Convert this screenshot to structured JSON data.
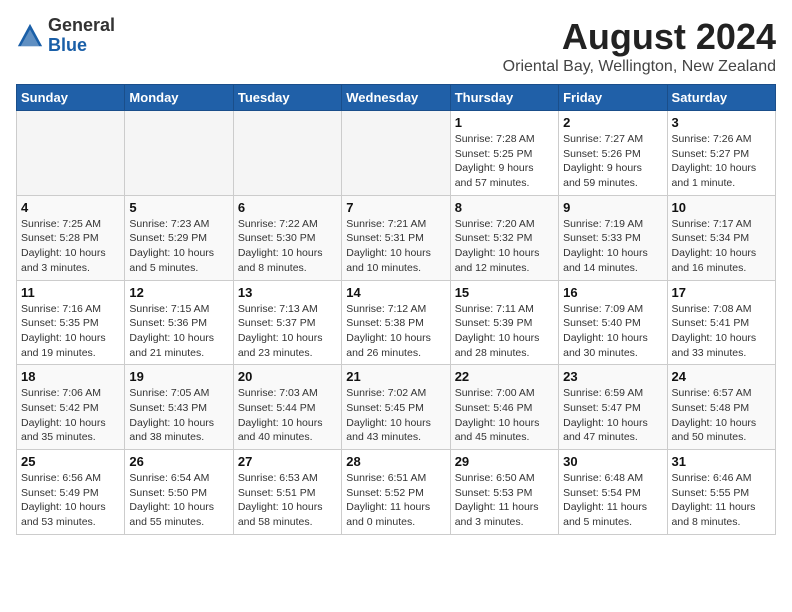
{
  "logo": {
    "general": "General",
    "blue": "Blue"
  },
  "title": {
    "month": "August 2024",
    "location": "Oriental Bay, Wellington, New Zealand"
  },
  "headers": [
    "Sunday",
    "Monday",
    "Tuesday",
    "Wednesday",
    "Thursday",
    "Friday",
    "Saturday"
  ],
  "weeks": [
    [
      {
        "day": "",
        "info": ""
      },
      {
        "day": "",
        "info": ""
      },
      {
        "day": "",
        "info": ""
      },
      {
        "day": "",
        "info": ""
      },
      {
        "day": "1",
        "info": "Sunrise: 7:28 AM\nSunset: 5:25 PM\nDaylight: 9 hours\nand 57 minutes."
      },
      {
        "day": "2",
        "info": "Sunrise: 7:27 AM\nSunset: 5:26 PM\nDaylight: 9 hours\nand 59 minutes."
      },
      {
        "day": "3",
        "info": "Sunrise: 7:26 AM\nSunset: 5:27 PM\nDaylight: 10 hours\nand 1 minute."
      }
    ],
    [
      {
        "day": "4",
        "info": "Sunrise: 7:25 AM\nSunset: 5:28 PM\nDaylight: 10 hours\nand 3 minutes."
      },
      {
        "day": "5",
        "info": "Sunrise: 7:23 AM\nSunset: 5:29 PM\nDaylight: 10 hours\nand 5 minutes."
      },
      {
        "day": "6",
        "info": "Sunrise: 7:22 AM\nSunset: 5:30 PM\nDaylight: 10 hours\nand 8 minutes."
      },
      {
        "day": "7",
        "info": "Sunrise: 7:21 AM\nSunset: 5:31 PM\nDaylight: 10 hours\nand 10 minutes."
      },
      {
        "day": "8",
        "info": "Sunrise: 7:20 AM\nSunset: 5:32 PM\nDaylight: 10 hours\nand 12 minutes."
      },
      {
        "day": "9",
        "info": "Sunrise: 7:19 AM\nSunset: 5:33 PM\nDaylight: 10 hours\nand 14 minutes."
      },
      {
        "day": "10",
        "info": "Sunrise: 7:17 AM\nSunset: 5:34 PM\nDaylight: 10 hours\nand 16 minutes."
      }
    ],
    [
      {
        "day": "11",
        "info": "Sunrise: 7:16 AM\nSunset: 5:35 PM\nDaylight: 10 hours\nand 19 minutes."
      },
      {
        "day": "12",
        "info": "Sunrise: 7:15 AM\nSunset: 5:36 PM\nDaylight: 10 hours\nand 21 minutes."
      },
      {
        "day": "13",
        "info": "Sunrise: 7:13 AM\nSunset: 5:37 PM\nDaylight: 10 hours\nand 23 minutes."
      },
      {
        "day": "14",
        "info": "Sunrise: 7:12 AM\nSunset: 5:38 PM\nDaylight: 10 hours\nand 26 minutes."
      },
      {
        "day": "15",
        "info": "Sunrise: 7:11 AM\nSunset: 5:39 PM\nDaylight: 10 hours\nand 28 minutes."
      },
      {
        "day": "16",
        "info": "Sunrise: 7:09 AM\nSunset: 5:40 PM\nDaylight: 10 hours\nand 30 minutes."
      },
      {
        "day": "17",
        "info": "Sunrise: 7:08 AM\nSunset: 5:41 PM\nDaylight: 10 hours\nand 33 minutes."
      }
    ],
    [
      {
        "day": "18",
        "info": "Sunrise: 7:06 AM\nSunset: 5:42 PM\nDaylight: 10 hours\nand 35 minutes."
      },
      {
        "day": "19",
        "info": "Sunrise: 7:05 AM\nSunset: 5:43 PM\nDaylight: 10 hours\nand 38 minutes."
      },
      {
        "day": "20",
        "info": "Sunrise: 7:03 AM\nSunset: 5:44 PM\nDaylight: 10 hours\nand 40 minutes."
      },
      {
        "day": "21",
        "info": "Sunrise: 7:02 AM\nSunset: 5:45 PM\nDaylight: 10 hours\nand 43 minutes."
      },
      {
        "day": "22",
        "info": "Sunrise: 7:00 AM\nSunset: 5:46 PM\nDaylight: 10 hours\nand 45 minutes."
      },
      {
        "day": "23",
        "info": "Sunrise: 6:59 AM\nSunset: 5:47 PM\nDaylight: 10 hours\nand 47 minutes."
      },
      {
        "day": "24",
        "info": "Sunrise: 6:57 AM\nSunset: 5:48 PM\nDaylight: 10 hours\nand 50 minutes."
      }
    ],
    [
      {
        "day": "25",
        "info": "Sunrise: 6:56 AM\nSunset: 5:49 PM\nDaylight: 10 hours\nand 53 minutes."
      },
      {
        "day": "26",
        "info": "Sunrise: 6:54 AM\nSunset: 5:50 PM\nDaylight: 10 hours\nand 55 minutes."
      },
      {
        "day": "27",
        "info": "Sunrise: 6:53 AM\nSunset: 5:51 PM\nDaylight: 10 hours\nand 58 minutes."
      },
      {
        "day": "28",
        "info": "Sunrise: 6:51 AM\nSunset: 5:52 PM\nDaylight: 11 hours\nand 0 minutes."
      },
      {
        "day": "29",
        "info": "Sunrise: 6:50 AM\nSunset: 5:53 PM\nDaylight: 11 hours\nand 3 minutes."
      },
      {
        "day": "30",
        "info": "Sunrise: 6:48 AM\nSunset: 5:54 PM\nDaylight: 11 hours\nand 5 minutes."
      },
      {
        "day": "31",
        "info": "Sunrise: 6:46 AM\nSunset: 5:55 PM\nDaylight: 11 hours\nand 8 minutes."
      }
    ]
  ]
}
